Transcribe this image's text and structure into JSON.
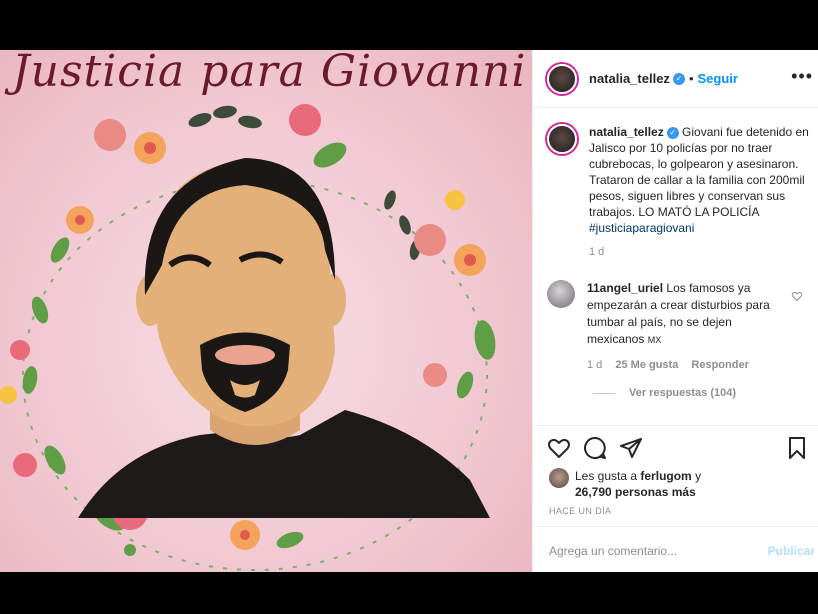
{
  "post": {
    "image_title": "Justicia para Giovanni",
    "author": "natalia_tellez",
    "follow_label": "Seguir",
    "caption": "Giovani fue detenido en Jalisco por 10 policías por no traer cubrebocas, lo golpearon y asesinaron. Trataron de callar a la familia con 200mil pesos, siguen libres y conservan sus trabajos. LO MATÓ LA POLICÍA",
    "hashtag": "#justiciaparagiovani",
    "caption_time": "1 d"
  },
  "comment": {
    "author": "11angel_uriel",
    "text": "Los famosos ya empezarán a crear disturbios para tumbar al país, no se dejen mexicanos",
    "flag_text": "MX",
    "time": "1 d",
    "likes": "25 Me gusta",
    "reply_label": "Responder",
    "view_replies": "Ver respuestas (104)"
  },
  "likes": {
    "prefix": "Les gusta a",
    "user": "ferlugom",
    "suffix": "y",
    "others": "26,790 personas más"
  },
  "posted_ago": "HACE UN DÍA",
  "add_comment": {
    "placeholder": "Agrega un comentario...",
    "publish_label": "Publicar"
  },
  "icons": {
    "like": "heart-icon",
    "comment": "comment-icon",
    "share": "paper-plane-icon",
    "save": "bookmark-icon",
    "more": "more-options-icon",
    "verified": "verified-badge-icon"
  },
  "colors": {
    "link_blue": "#0095f6",
    "image_bg": "#f1c9d2",
    "title_color": "#6b1a2e"
  }
}
